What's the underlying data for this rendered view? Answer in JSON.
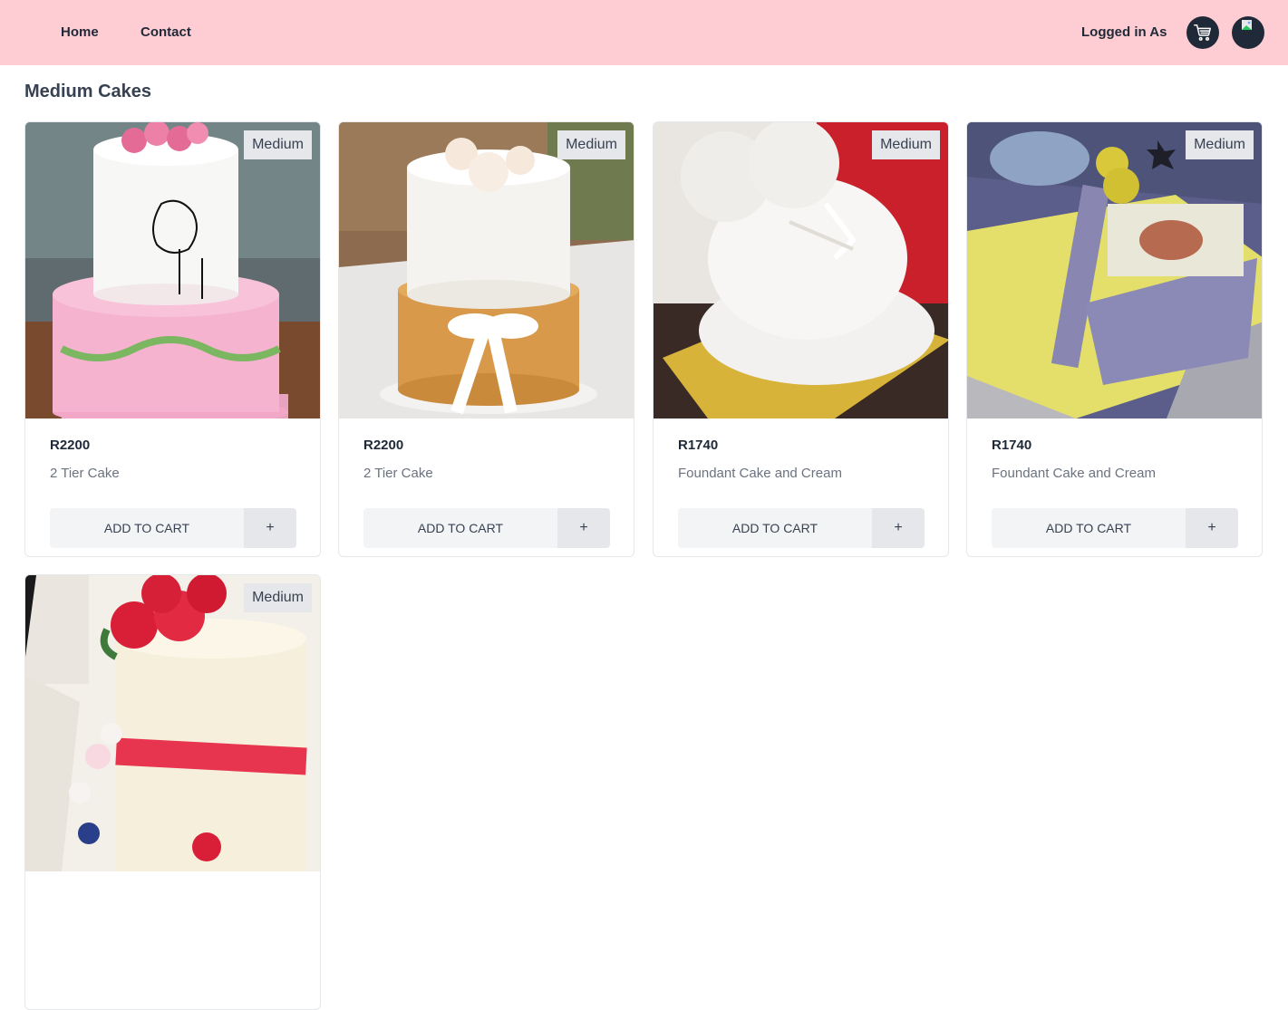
{
  "nav": {
    "home_label": "Home",
    "contact_label": "Contact",
    "logged_in_label": "Logged in As",
    "cart_icon": "shopping-cart-icon",
    "avatar_icon": "user-avatar"
  },
  "page": {
    "title": "Medium Cakes"
  },
  "products": [
    {
      "badge": "Medium",
      "price": "R2200",
      "name": "2 Tier Cake",
      "add_label": "ADD TO CART",
      "plus_label": "+"
    },
    {
      "badge": "Medium",
      "price": "R2200",
      "name": "2 Tier Cake",
      "add_label": "ADD TO CART",
      "plus_label": "+"
    },
    {
      "badge": "Medium",
      "price": "R1740",
      "name": "Foundant Cake and Cream",
      "add_label": "ADD TO CART",
      "plus_label": "+"
    },
    {
      "badge": "Medium",
      "price": "R1740",
      "name": "Foundant Cake and Cream",
      "add_label": "ADD TO CART",
      "plus_label": "+"
    },
    {
      "badge": "Medium"
    }
  ],
  "colors": {
    "navbar": "#fecdd3",
    "icon_bg": "#1f2937",
    "button_bg": "#f3f4f6",
    "badge_bg": "#e5e7eb"
  }
}
